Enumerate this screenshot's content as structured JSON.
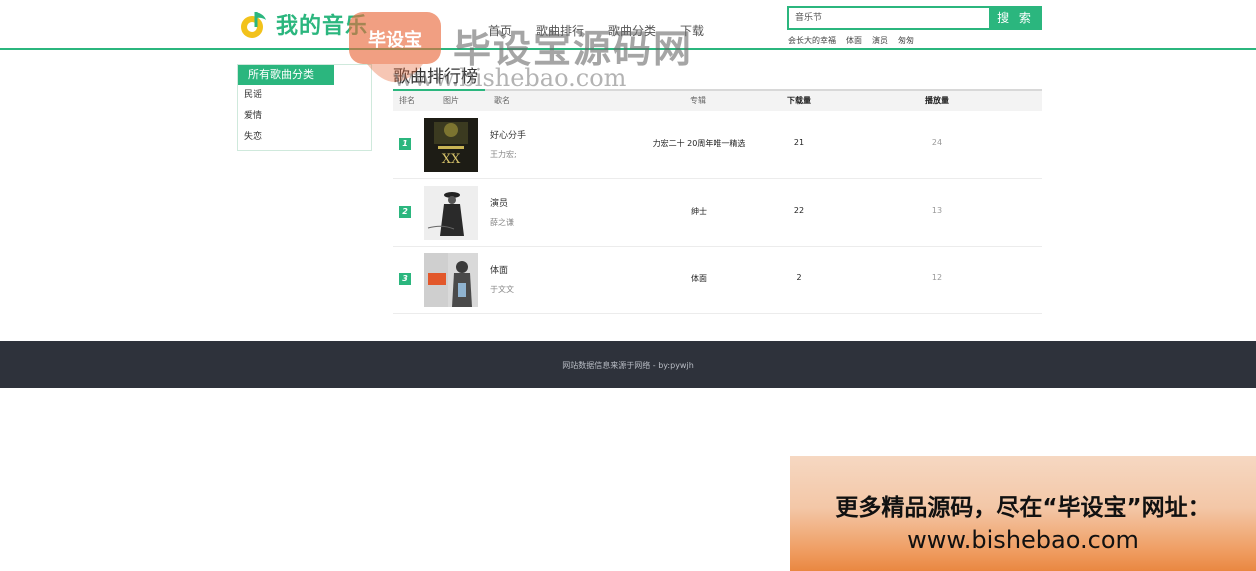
{
  "header": {
    "logo_text": "我的音乐",
    "nav": [
      "首页",
      "歌曲排行",
      "歌曲分类",
      "下载"
    ],
    "search_value": "音乐节",
    "search_button": "搜 索",
    "hot_tags": [
      "会长大的幸福",
      "体面",
      "演员",
      "匆匆"
    ]
  },
  "sidebar": {
    "title": "所有歌曲分类",
    "items": [
      "民谣",
      "爱情",
      "失恋"
    ]
  },
  "ranking": {
    "title": "歌曲排行榜",
    "columns": [
      "排名",
      "图片",
      "歌名",
      "专辑",
      "下载量",
      "播放量"
    ],
    "rows": [
      {
        "rank": "1",
        "song": "好心分手",
        "artist": "王力宏;",
        "album": "力宏二十 20周年唯一精选",
        "downloads": "21",
        "plays": "24"
      },
      {
        "rank": "2",
        "song": "演员",
        "artist": "薛之谦",
        "album": "绅士",
        "downloads": "22",
        "plays": "13"
      },
      {
        "rank": "3",
        "song": "体面",
        "artist": "于文文",
        "album": "体面",
        "downloads": "2",
        "plays": "12"
      }
    ]
  },
  "footer": {
    "text": "网站数据信息来源于网络 - by:pywjh"
  },
  "watermark": {
    "badge": "毕设宝",
    "brand": "毕设宝源码网",
    "url": "www.bishebao.com"
  },
  "promo": {
    "line1": "更多精品源码，尽在“毕设宝”网址：",
    "line2": "www.bishebao.com"
  },
  "colors": {
    "accent": "#2bb67e",
    "footer_bg": "#2e323b"
  }
}
